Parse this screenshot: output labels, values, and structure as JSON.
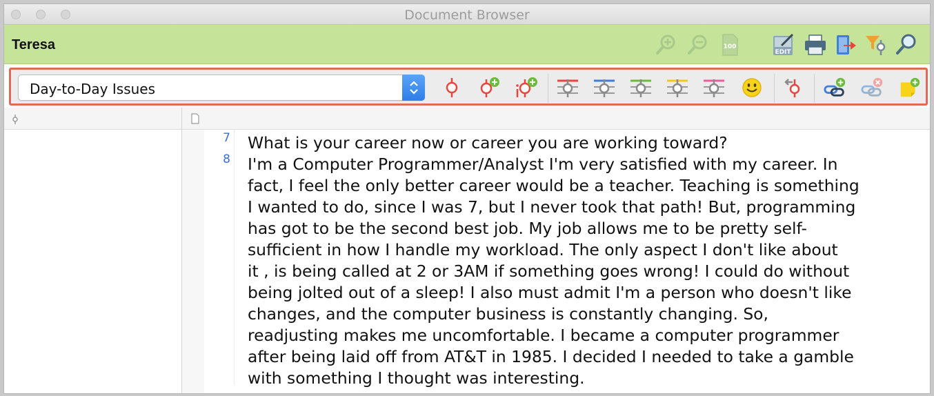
{
  "window": {
    "title": "Document Browser"
  },
  "document": {
    "name": "Teresa"
  },
  "header_icons": [
    "zoom-in-icon",
    "zoom-out-icon",
    "zoom-100-icon",
    "edit-icon",
    "print-icon",
    "export-icon",
    "filter-icon",
    "search-icon"
  ],
  "toolbar": {
    "code_selector_value": "Day-to-Day Issues",
    "buttons": [
      "code-icon",
      "code-new-icon",
      "in-vivo-code-icon",
      "highlight-red-icon",
      "highlight-blue-icon",
      "highlight-green-icon",
      "highlight-yellow-icon",
      "highlight-magenta-icon",
      "emoticon-icon",
      "undo-code-icon",
      "link-new-icon",
      "link-delete-icon",
      "memo-new-icon"
    ],
    "colors": {
      "red": "#e8463c",
      "blue": "#3f7fd6",
      "green": "#6cbb3c",
      "yellow": "#f2c81f",
      "magenta": "#e8609a",
      "accent_green": "#c5e49a"
    }
  },
  "content": {
    "paragraphs": [
      {
        "number": "7",
        "lines": [
          "What is your career now or career you are working toward?"
        ]
      },
      {
        "number": "8",
        "lines": [
          "I'm a Computer Programmer/Analyst I'm very satisfied with my career.  In",
          "fact, I feel the only better career would be a teacher.  Teaching is something",
          "I wanted to do, since I was 7, but I never took that path!  But, programming",
          "has got to be the second best job.  My job allows me to be pretty self-",
          "sufficient in how I handle my workload.  The only aspect I don't like about",
          "it , is being called at 2 or 3AM  if something goes wrong!  I could do without",
          "being jolted out of a sleep!  I also must admit I'm a person who doesn't like",
          "changes, and the computer business is constantly changing.  So,",
          "readjusting makes me uncomfortable.  I became a computer programmer",
          "after being laid off from AT&T in 1985.  I decided I needed to take a gamble",
          "with something I thought was interesting."
        ]
      }
    ]
  }
}
